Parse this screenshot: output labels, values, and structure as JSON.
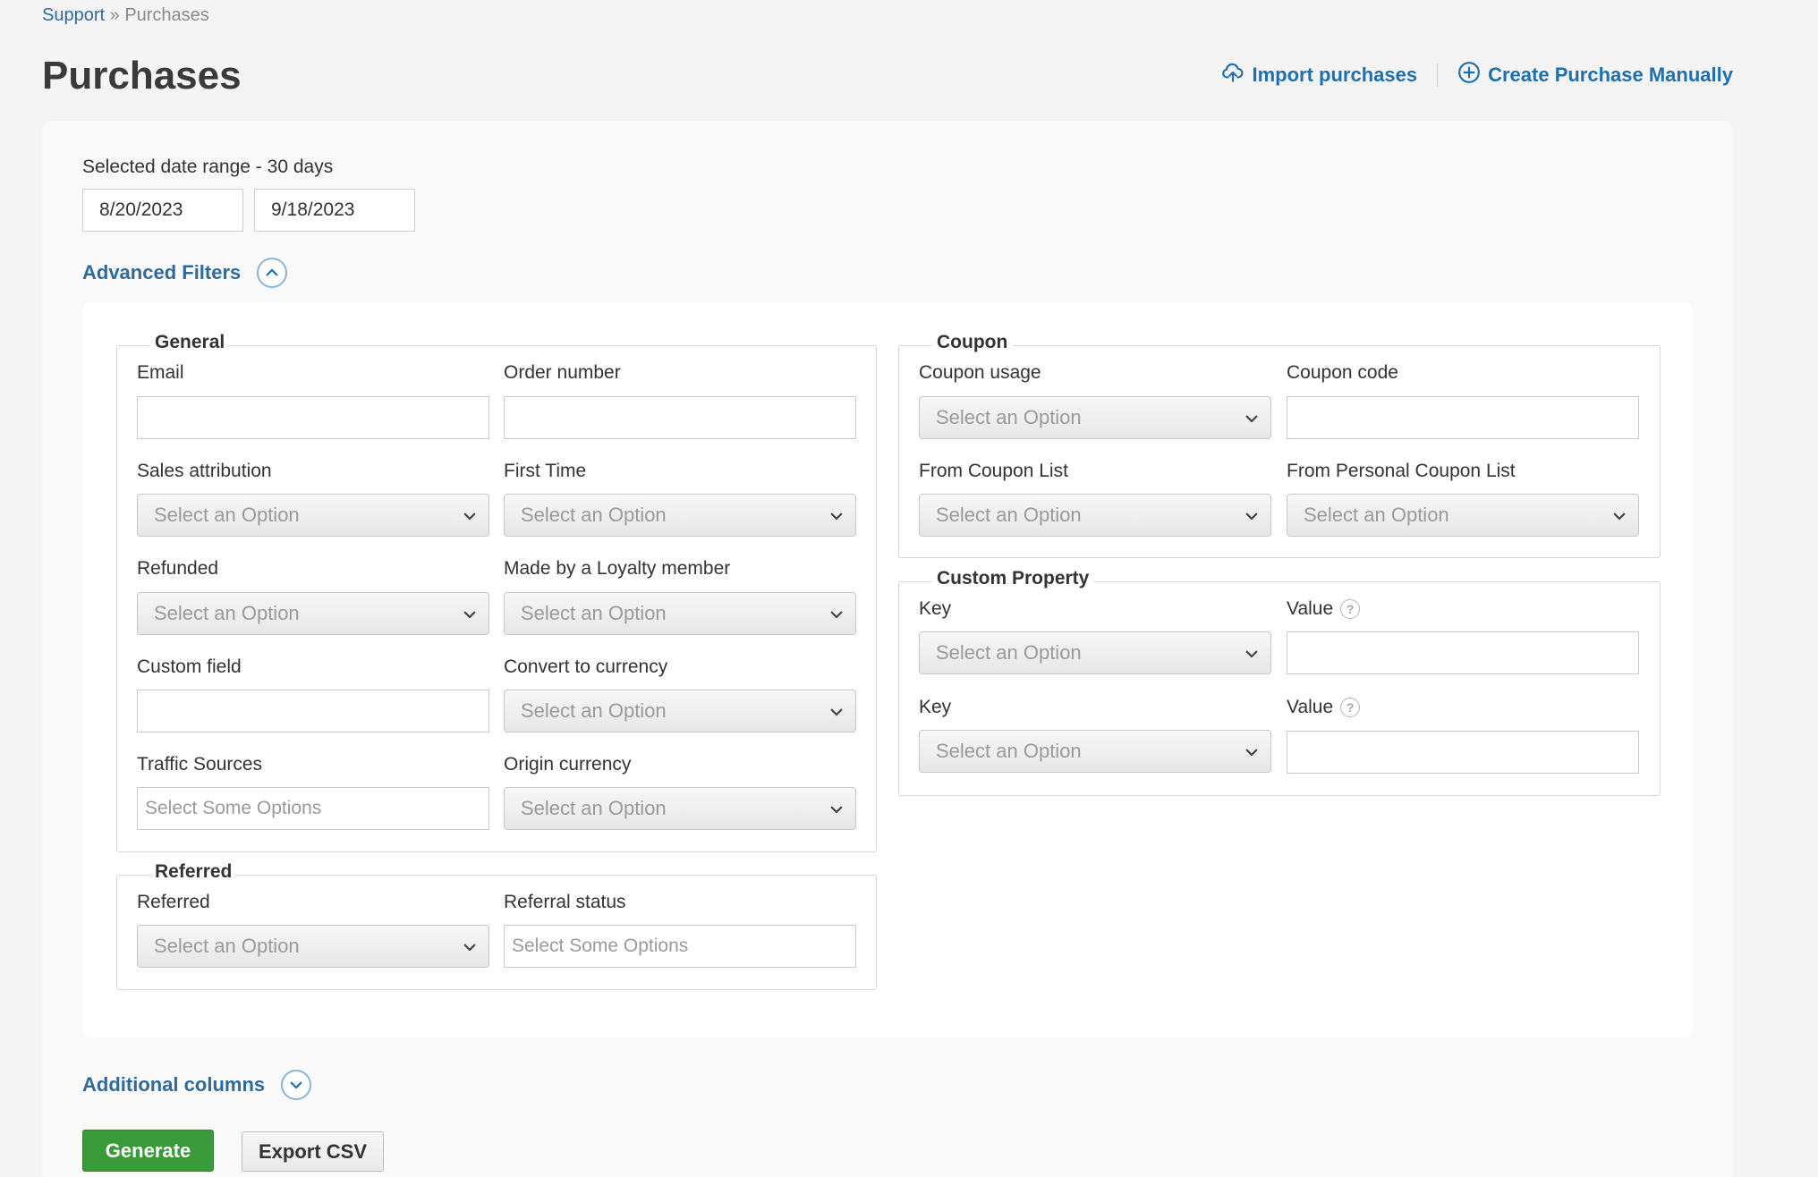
{
  "breadcrumb": {
    "root": "Support",
    "separator": "»",
    "current": "Purchases"
  },
  "page_title": "Purchases",
  "actions": {
    "import": {
      "label": "Import purchases",
      "icon": "upload-cloud-icon"
    },
    "create": {
      "label": "Create Purchase Manually",
      "icon": "plus-circle-icon"
    }
  },
  "date_range": {
    "label": "Selected date range - 30 days",
    "start": "8/20/2023",
    "end": "9/18/2023"
  },
  "advanced_filters": {
    "label": "Advanced Filters",
    "expanded": true,
    "icon": "chevron-up-icon"
  },
  "general": {
    "legend": "General",
    "email": {
      "label": "Email",
      "value": ""
    },
    "order_number": {
      "label": "Order number",
      "value": ""
    },
    "sales_attribution": {
      "label": "Sales attribution",
      "value": "Select an Option"
    },
    "first_time": {
      "label": "First Time",
      "value": "Select an Option"
    },
    "refunded": {
      "label": "Refunded",
      "value": "Select an Option"
    },
    "loyalty_member": {
      "label": "Made by a Loyalty member",
      "value": "Select an Option"
    },
    "custom_field": {
      "label": "Custom field",
      "value": ""
    },
    "convert_currency": {
      "label": "Convert to currency",
      "value": "Select an Option"
    },
    "traffic_sources": {
      "label": "Traffic Sources",
      "placeholder": "Select Some Options"
    },
    "origin_currency": {
      "label": "Origin currency",
      "value": "Select an Option"
    }
  },
  "referred": {
    "legend": "Referred",
    "referred": {
      "label": "Referred",
      "value": "Select an Option"
    },
    "referral_status": {
      "label": "Referral status",
      "placeholder": "Select Some Options"
    }
  },
  "coupon": {
    "legend": "Coupon",
    "coupon_usage": {
      "label": "Coupon usage",
      "value": "Select an Option"
    },
    "coupon_code": {
      "label": "Coupon code",
      "value": ""
    },
    "from_coupon_list": {
      "label": "From Coupon List",
      "value": "Select an Option"
    },
    "from_personal_coupon_list": {
      "label": "From Personal Coupon List",
      "value": "Select an Option"
    }
  },
  "custom_property": {
    "legend": "Custom Property",
    "rows": [
      {
        "key_label": "Key",
        "key_value": "Select an Option",
        "value_label": "Value",
        "help": "?"
      },
      {
        "key_label": "Key",
        "key_value": "Select an Option",
        "value_label": "Value",
        "help": "?"
      }
    ]
  },
  "additional_columns": {
    "label": "Additional columns",
    "expanded": false,
    "icon": "chevron-down-icon"
  },
  "buttons": {
    "generate": "Generate",
    "export": "Export CSV"
  },
  "colors": {
    "link": "#1f6fae",
    "generate": "#3a9a3a",
    "background": "#f4f4f4"
  }
}
